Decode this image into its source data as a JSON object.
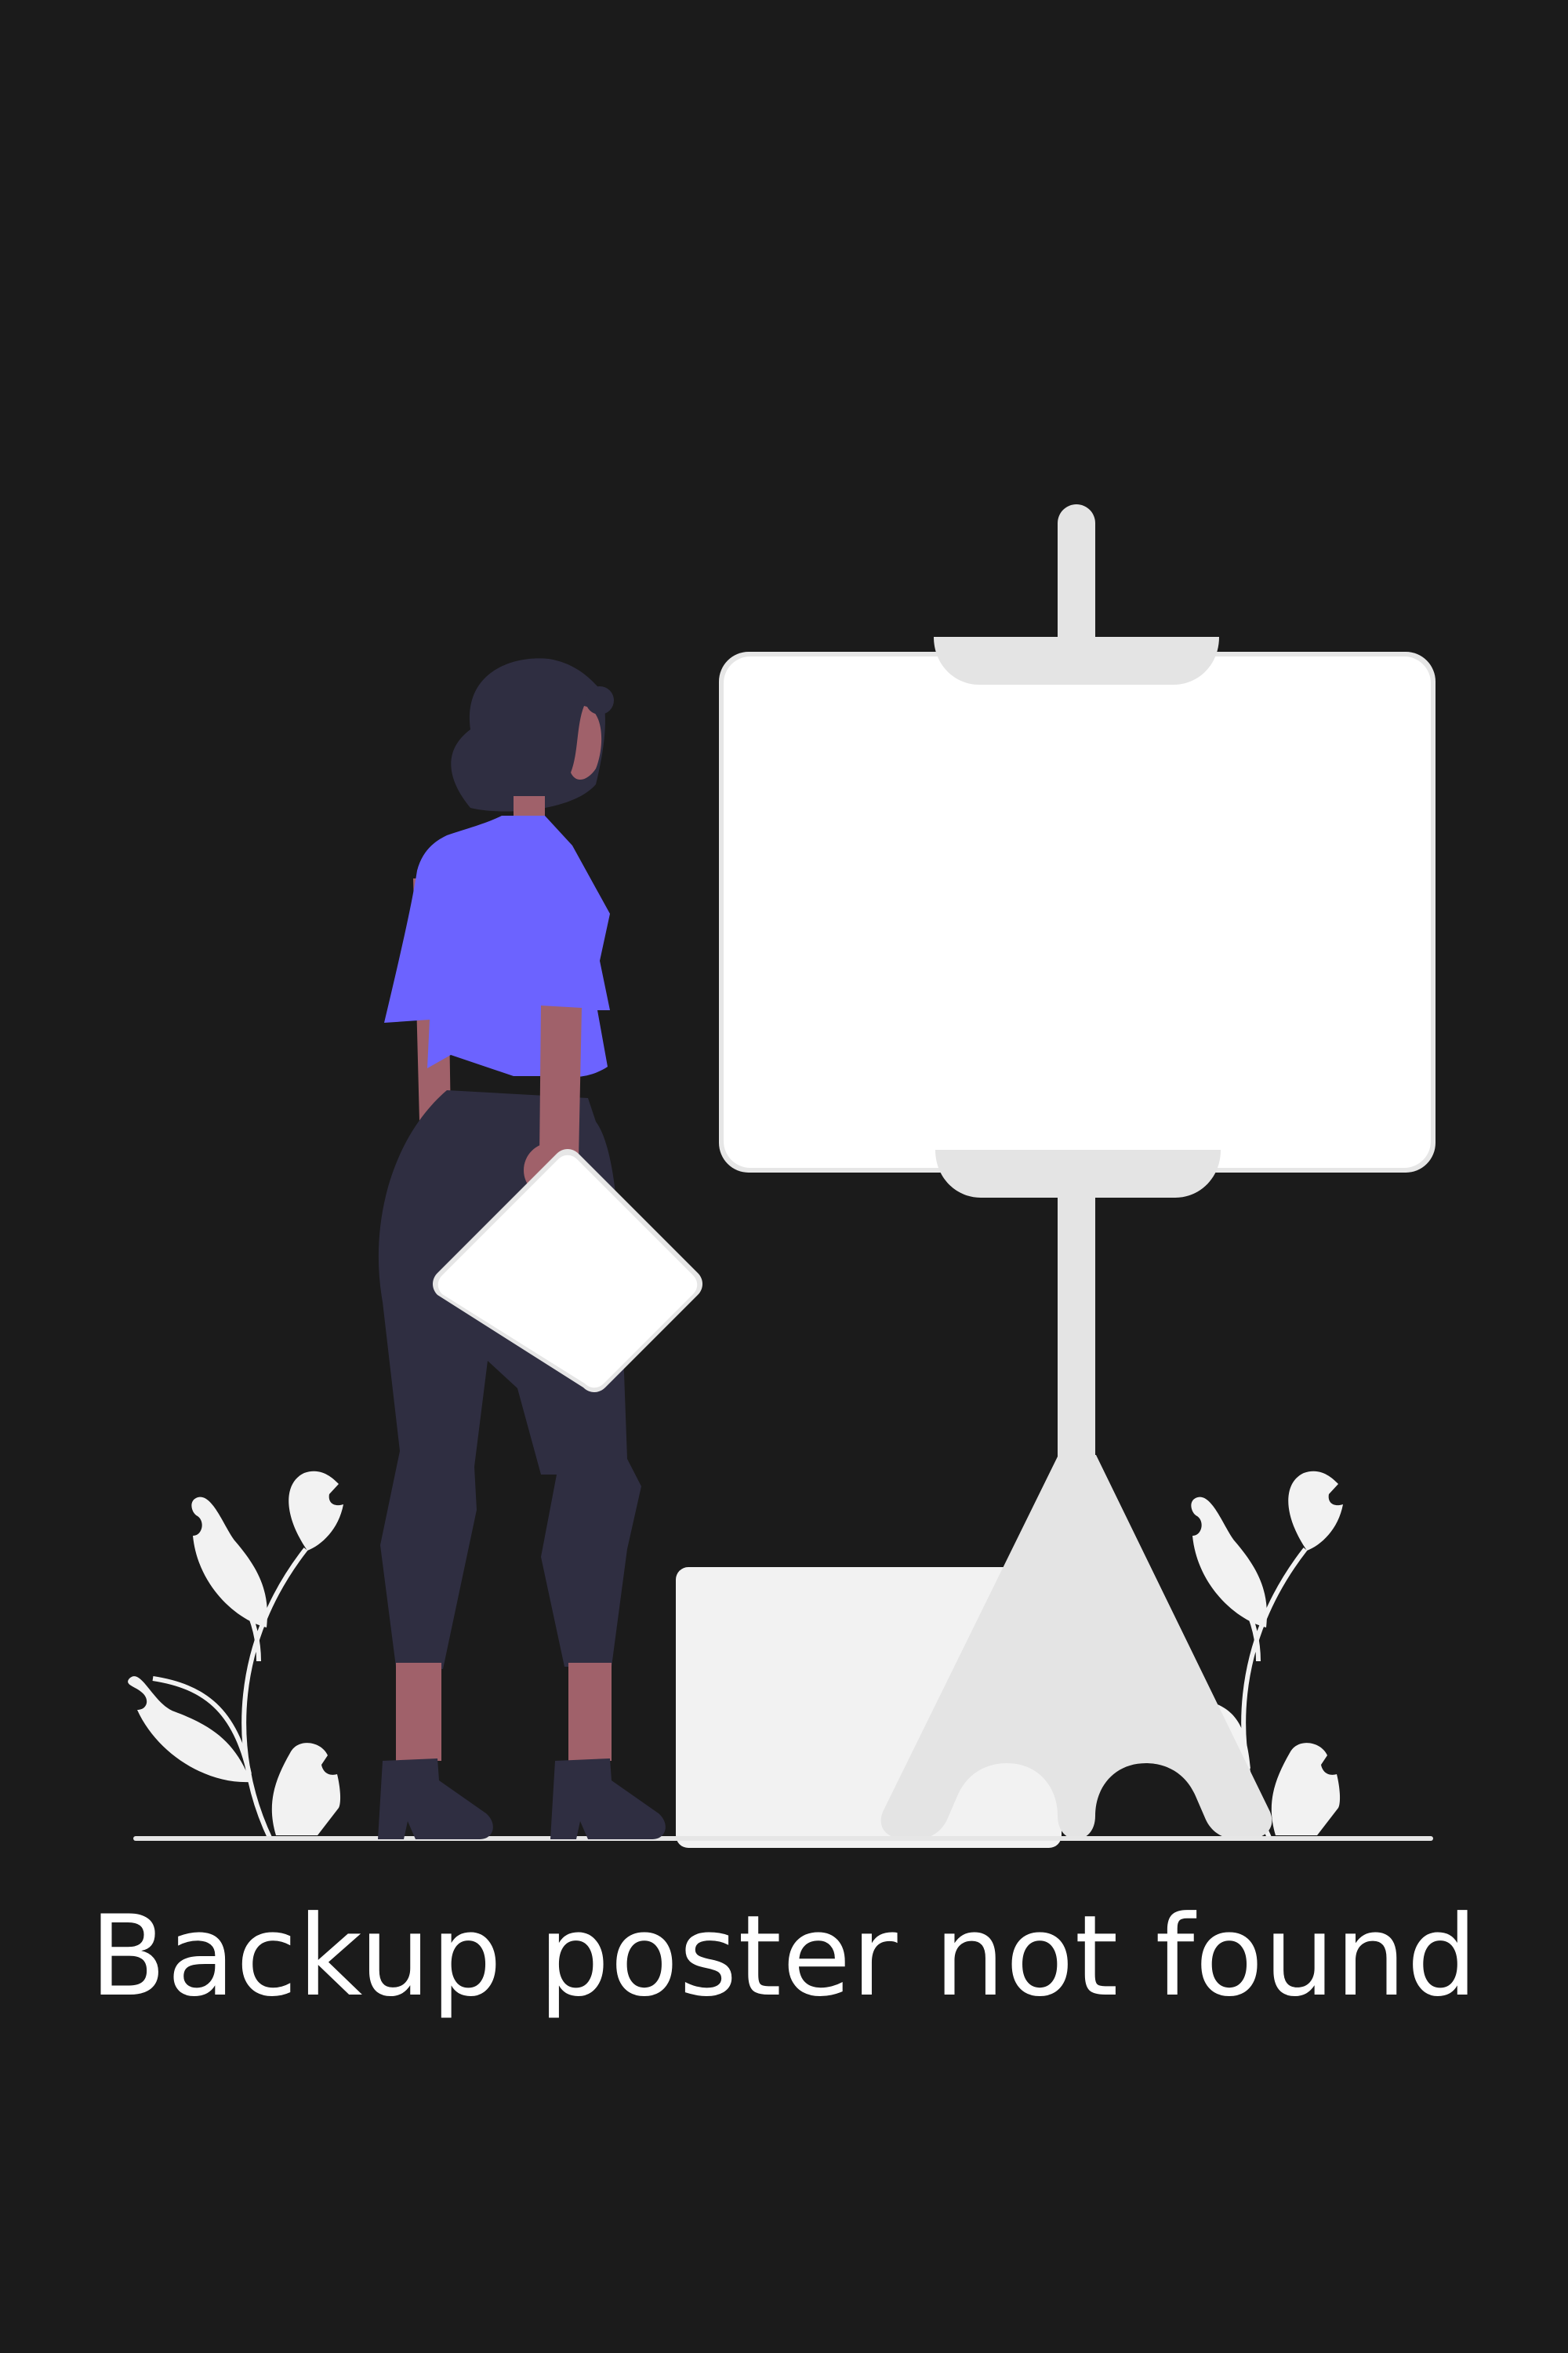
{
  "message": "Backup poster not found",
  "colors": {
    "background": "#1b1b1b",
    "text": "#ffffff",
    "board": "#ffffff",
    "stand": "#e4e4e4",
    "box": "#f2f2f2",
    "shirt": "#6c63ff",
    "pants": "#2f2e41",
    "skin": "#a0616a",
    "plant": "#f2f2f2",
    "ground": "#e6e6e6"
  },
  "icons": {
    "illustration": "person-with-empty-poster-board-illustration"
  }
}
